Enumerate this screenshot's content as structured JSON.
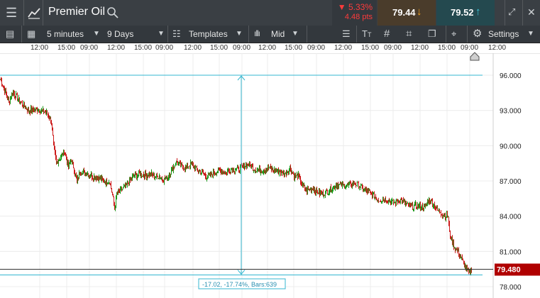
{
  "header": {
    "instrument": "Premier Oil",
    "change_percent": "▼ 5.33%",
    "change_points": "4.48 pts",
    "sell_price": "79.44",
    "buy_price": "79.52"
  },
  "toolbar": {
    "interval": "5 minutes",
    "range": "9 Days",
    "templates": "Templates",
    "price_type": "Mid",
    "settings": "Settings"
  },
  "time_axis": {
    "labels": [
      "12:00",
      "15:00",
      "09:00",
      "12:00",
      "15:00",
      "09:00",
      "12:00",
      "15:00",
      "09:00",
      "12:00",
      "15:00",
      "09:00",
      "12:00",
      "15:00",
      "09:00",
      "12:00",
      "15:00",
      "09:00",
      "12:00"
    ]
  },
  "price_axis": {
    "labels": [
      "96.000",
      "93.000",
      "90.000",
      "87.000",
      "84.000",
      "81.000",
      "78.000"
    ],
    "current_price": "79.480"
  },
  "measure": {
    "label": "-17.02, -17.74%, Bars:639"
  },
  "colors": {
    "up": "#1a9a1a",
    "down": "#cc1b1b",
    "drawing": "#34b7d1",
    "price_tag": "#b00000"
  },
  "chart_data": {
    "type": "candlestick",
    "title": "",
    "xlabel": "",
    "ylabel": "",
    "ylim": [
      77.5,
      98.5
    ],
    "y_ticks": [
      96,
      93,
      90,
      87,
      84,
      81,
      78
    ],
    "grid": true,
    "measurement": {
      "from": 96.0,
      "to": 79.0,
      "delta": -17.02,
      "percent": -17.74,
      "bars": 639
    },
    "current_price": 79.48,
    "series": [
      {
        "name": "",
        "close_path": [
          [
            0,
            95.7
          ],
          [
            6,
            94.7
          ],
          [
            12,
            93.7
          ],
          [
            18,
            94.6
          ],
          [
            24,
            94.0
          ],
          [
            30,
            93.6
          ],
          [
            40,
            93.0
          ],
          [
            52,
            93.1
          ],
          [
            62,
            92.9
          ],
          [
            68,
            92.6
          ],
          [
            72,
            92.0
          ],
          [
            75,
            90.0
          ],
          [
            79,
            88.5
          ],
          [
            84,
            89.0
          ],
          [
            90,
            89.5
          ],
          [
            96,
            88.2
          ],
          [
            100,
            88.8
          ],
          [
            104,
            88.0
          ],
          [
            108,
            86.9
          ],
          [
            112,
            87.8
          ],
          [
            120,
            87.7
          ],
          [
            130,
            87.4
          ],
          [
            140,
            87.2
          ],
          [
            148,
            86.9
          ],
          [
            154,
            87.0
          ],
          [
            158,
            85.8
          ],
          [
            161,
            84.7
          ],
          [
            164,
            85.8
          ],
          [
            170,
            86.2
          ],
          [
            178,
            86.6
          ],
          [
            186,
            87.3
          ],
          [
            196,
            87.6
          ],
          [
            204,
            87.5
          ],
          [
            212,
            87.6
          ],
          [
            218,
            87.4
          ],
          [
            224,
            87.4
          ],
          [
            230,
            87.1
          ],
          [
            236,
            87.3
          ],
          [
            242,
            88.0
          ],
          [
            248,
            88.6
          ],
          [
            254,
            88.3
          ],
          [
            260,
            88.1
          ],
          [
            268,
            88.4
          ],
          [
            276,
            88.0
          ],
          [
            284,
            87.7
          ],
          [
            290,
            87.4
          ],
          [
            296,
            87.5
          ],
          [
            302,
            87.7
          ],
          [
            310,
            87.9
          ],
          [
            318,
            87.7
          ],
          [
            326,
            88.0
          ],
          [
            334,
            88.0
          ],
          [
            342,
            88.2
          ],
          [
            350,
            88.4
          ],
          [
            356,
            88.1
          ],
          [
            362,
            87.9
          ],
          [
            370,
            87.9
          ],
          [
            378,
            88.1
          ],
          [
            386,
            87.9
          ],
          [
            394,
            87.8
          ],
          [
            402,
            87.6
          ],
          [
            408,
            88.1
          ],
          [
            414,
            87.4
          ],
          [
            420,
            87.4
          ],
          [
            426,
            86.6
          ],
          [
            432,
            86.2
          ],
          [
            440,
            86.4
          ],
          [
            446,
            86.1
          ],
          [
            452,
            85.9
          ],
          [
            458,
            86.0
          ],
          [
            466,
            86.3
          ],
          [
            474,
            86.7
          ],
          [
            482,
            86.6
          ],
          [
            490,
            86.6
          ],
          [
            498,
            86.8
          ],
          [
            506,
            86.6
          ],
          [
            514,
            86.2
          ],
          [
            520,
            86.0
          ],
          [
            526,
            85.8
          ],
          [
            532,
            85.4
          ],
          [
            538,
            85.4
          ],
          [
            544,
            85.5
          ],
          [
            550,
            85.2
          ],
          [
            556,
            85.1
          ],
          [
            562,
            85.4
          ],
          [
            568,
            85.2
          ],
          [
            574,
            84.9
          ],
          [
            580,
            84.8
          ],
          [
            586,
            84.9
          ],
          [
            592,
            84.8
          ],
          [
            598,
            84.7
          ],
          [
            604,
            85.4
          ],
          [
            608,
            85.2
          ],
          [
            612,
            84.9
          ],
          [
            616,
            84.5
          ],
          [
            620,
            84.4
          ],
          [
            624,
            84.1
          ],
          [
            628,
            84.0
          ],
          [
            631,
            84.0
          ],
          [
            633,
            82.6
          ],
          [
            636,
            82.0
          ],
          [
            640,
            81.3
          ],
          [
            644,
            81.1
          ],
          [
            648,
            80.6
          ],
          [
            652,
            80.1
          ],
          [
            656,
            79.6
          ],
          [
            660,
            79.2
          ],
          [
            664,
            79.4
          ]
        ]
      }
    ]
  }
}
